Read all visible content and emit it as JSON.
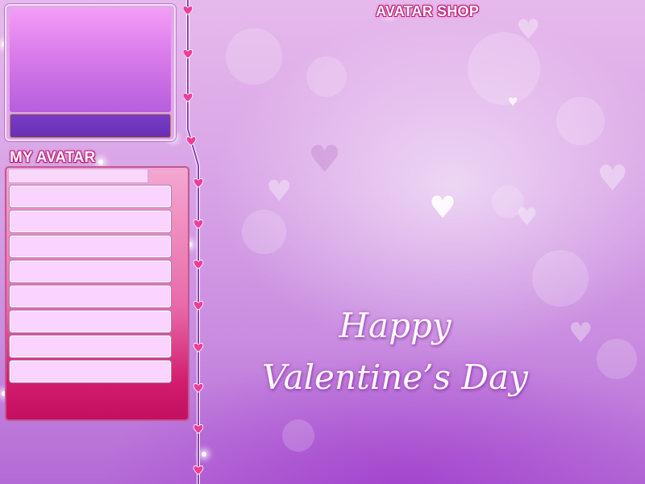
{
  "shop": {
    "title": "AVATAR SHOP"
  },
  "my_avatar": {
    "title": "MY AVATAR",
    "slot_count": 8
  },
  "greeting": {
    "line1": "Happy",
    "line2": "Valentine’s Day"
  },
  "colors": {
    "title_outline": "#c2187a",
    "panel_pink": "#d21d6e",
    "slot_fill": "#fad3ff",
    "preview_purple": "#6a2eb5",
    "divider_heart": "#f03c9a"
  },
  "divider": {
    "icon": "heart-icon",
    "heart_count": 12
  }
}
